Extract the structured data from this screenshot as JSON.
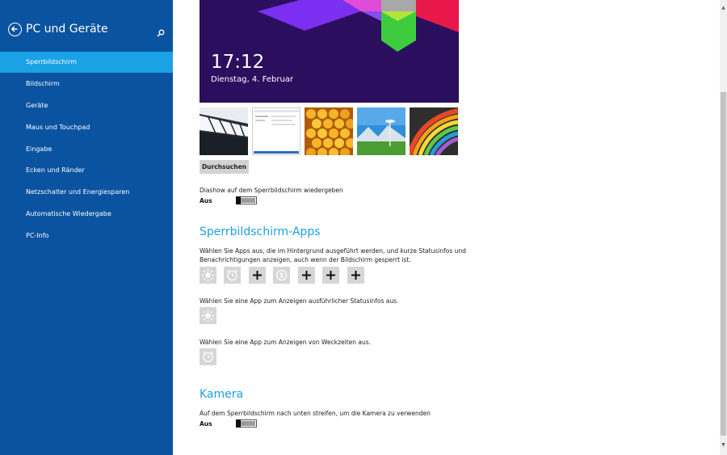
{
  "sidebar": {
    "title": "PC und Geräte",
    "items": [
      {
        "label": "Sperrbildschirm",
        "selected": true
      },
      {
        "label": "Bildschirm"
      },
      {
        "label": "Geräte"
      },
      {
        "label": "Maus und Touchpad"
      },
      {
        "label": "Eingabe"
      },
      {
        "label": "Ecken und Ränder"
      },
      {
        "label": "Netzschalter und Energiesparen"
      },
      {
        "label": "Automatische Wiedergabe"
      },
      {
        "label": "PC-Info"
      }
    ],
    "icons": {
      "back": "back-arrow-icon",
      "search": "search-icon"
    },
    "bg_color": "#0a53a0",
    "selected_color": "#1aa1e6"
  },
  "lockscreen": {
    "time": "17:12",
    "date": "Dienstag, 4. Februar",
    "thumbnails": [
      "piano-keys",
      "screenshot",
      "honeycomb",
      "space-needle",
      "color-stripes"
    ],
    "browse_label": "Durchsuchen",
    "slideshow_label": "Diashow auf dem Sperrbildschirm wiedergeben",
    "slideshow_state": "Aus"
  },
  "apps": {
    "heading": "Sperrbildschirm-Apps",
    "description_line1": "Wählen Sie Apps aus, die im Hintergrund ausgeführt werden, und kurze Statusinfos und",
    "description_line2": "Benachrichtigungen anzeigen, auch wenn der Bildschirm gesperrt ist.",
    "tiles": [
      "weather-icon",
      "alarm-icon",
      "plus-icon",
      "skype-icon",
      "plus-icon",
      "plus-icon",
      "plus-icon"
    ],
    "detailed_label": "Wählen Sie eine App zum Anzeigen ausführlicher Statusinfos aus.",
    "detailed_tile": "weather-icon",
    "alarm_label": "Wählen Sie eine App zum Anzeigen von Weckzeiten aus.",
    "alarm_tile": "alarm-icon"
  },
  "camera": {
    "heading": "Kamera",
    "description": "Auf dem Sperrbildschirm nach unten streifen, um die Kamera zu verwenden",
    "state": "Aus"
  },
  "accent_color": "#1aa1e6"
}
